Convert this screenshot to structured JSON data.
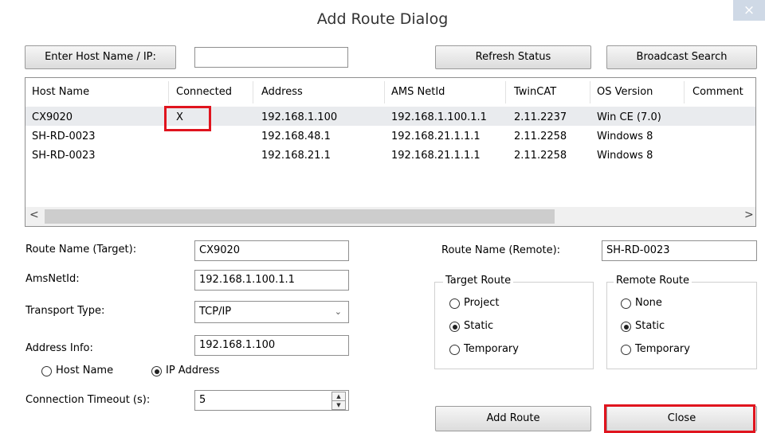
{
  "dialog": {
    "title": "Add Route Dialog",
    "close_glyph": "×"
  },
  "top": {
    "enter_host_label": "Enter Host Name / IP:",
    "host_value": "",
    "refresh_label": "Refresh Status",
    "broadcast_label": "Broadcast Search"
  },
  "table": {
    "columns": [
      "Host Name",
      "Connected",
      "Address",
      "AMS NetId",
      "TwinCAT",
      "OS Version",
      "Comment"
    ],
    "rows": [
      {
        "host": "CX9020",
        "connected": "X",
        "address": "192.168.1.100",
        "ams": "192.168.1.100.1.1",
        "twincat": "2.11.2237",
        "os": "Win CE (7.0)",
        "comment": ""
      },
      {
        "host": "SH-RD-0023",
        "connected": "",
        "address": "192.168.48.1",
        "ams": "192.168.21.1.1.1",
        "twincat": "2.11.2258",
        "os": "Windows 8",
        "comment": ""
      },
      {
        "host": "SH-RD-0023",
        "connected": "",
        "address": "192.168.21.1",
        "ams": "192.168.21.1.1.1",
        "twincat": "2.11.2258",
        "os": "Windows 8",
        "comment": ""
      }
    ],
    "scroll_left": "<",
    "scroll_right": ">"
  },
  "form": {
    "route_name_target_label": "Route Name (Target):",
    "route_name_target_value": "CX9020",
    "amsnetid_label": "AmsNetId:",
    "amsnetid_value": "192.168.1.100.1.1",
    "transport_label": "Transport Type:",
    "transport_value": "TCP/IP",
    "address_info_label": "Address Info:",
    "address_info_value": "192.168.1.100",
    "host_name_option": "Host Name",
    "ip_address_option": "IP Address",
    "address_mode_selected": "IP Address",
    "timeout_label": "Connection Timeout (s):",
    "timeout_value": "5",
    "route_name_remote_label": "Route Name (Remote):",
    "route_name_remote_value": "SH-RD-0023"
  },
  "target_route": {
    "legend": "Target Route",
    "options": [
      "Project",
      "Static",
      "Temporary"
    ],
    "selected": "Static"
  },
  "remote_route": {
    "legend": "Remote Route",
    "options": [
      "None",
      "Static",
      "Temporary"
    ],
    "selected": "Static"
  },
  "buttons": {
    "add_route": "Add Route",
    "close": "Close"
  },
  "colors": {
    "highlight": "#e0141e",
    "selected_row": "#e9ebee"
  }
}
